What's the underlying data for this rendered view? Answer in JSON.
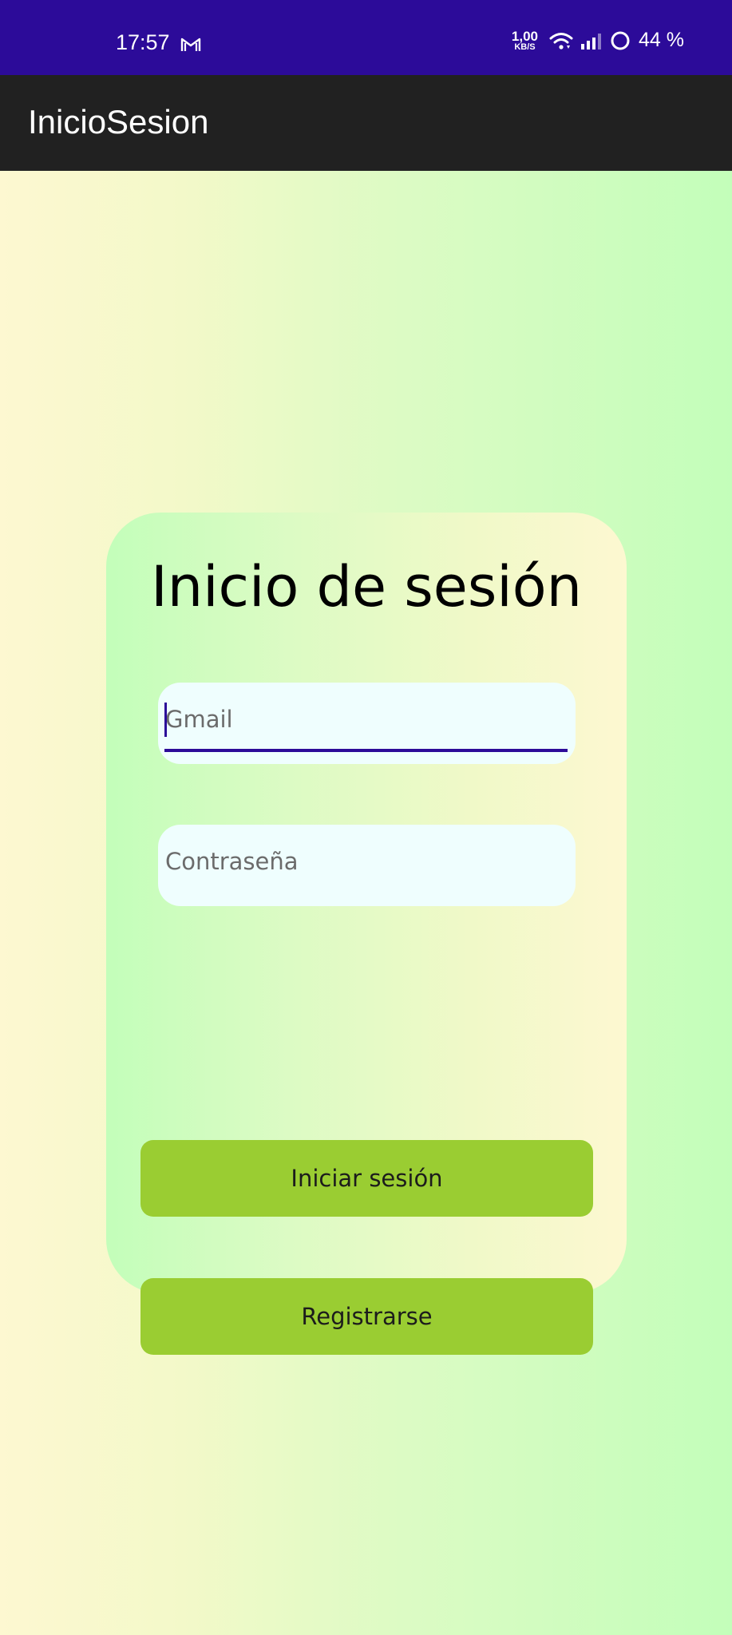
{
  "status_bar": {
    "time": "17:57",
    "mail_icon": "gmail-icon",
    "net_speed_value": "1,00",
    "net_speed_unit": "KB/S",
    "battery": "44 %",
    "background": "#2c0b99"
  },
  "app_bar": {
    "title": "InicioSesion",
    "background": "#212121"
  },
  "card": {
    "title": "Inicio de sesión",
    "email_placeholder": "Gmail",
    "password_placeholder": "Contraseña",
    "login_label": "Iniciar sesión",
    "register_label": "Registrarse",
    "button_color": "#9acd32",
    "field_color": "#effefe",
    "accent_color": "#2c0b99"
  }
}
